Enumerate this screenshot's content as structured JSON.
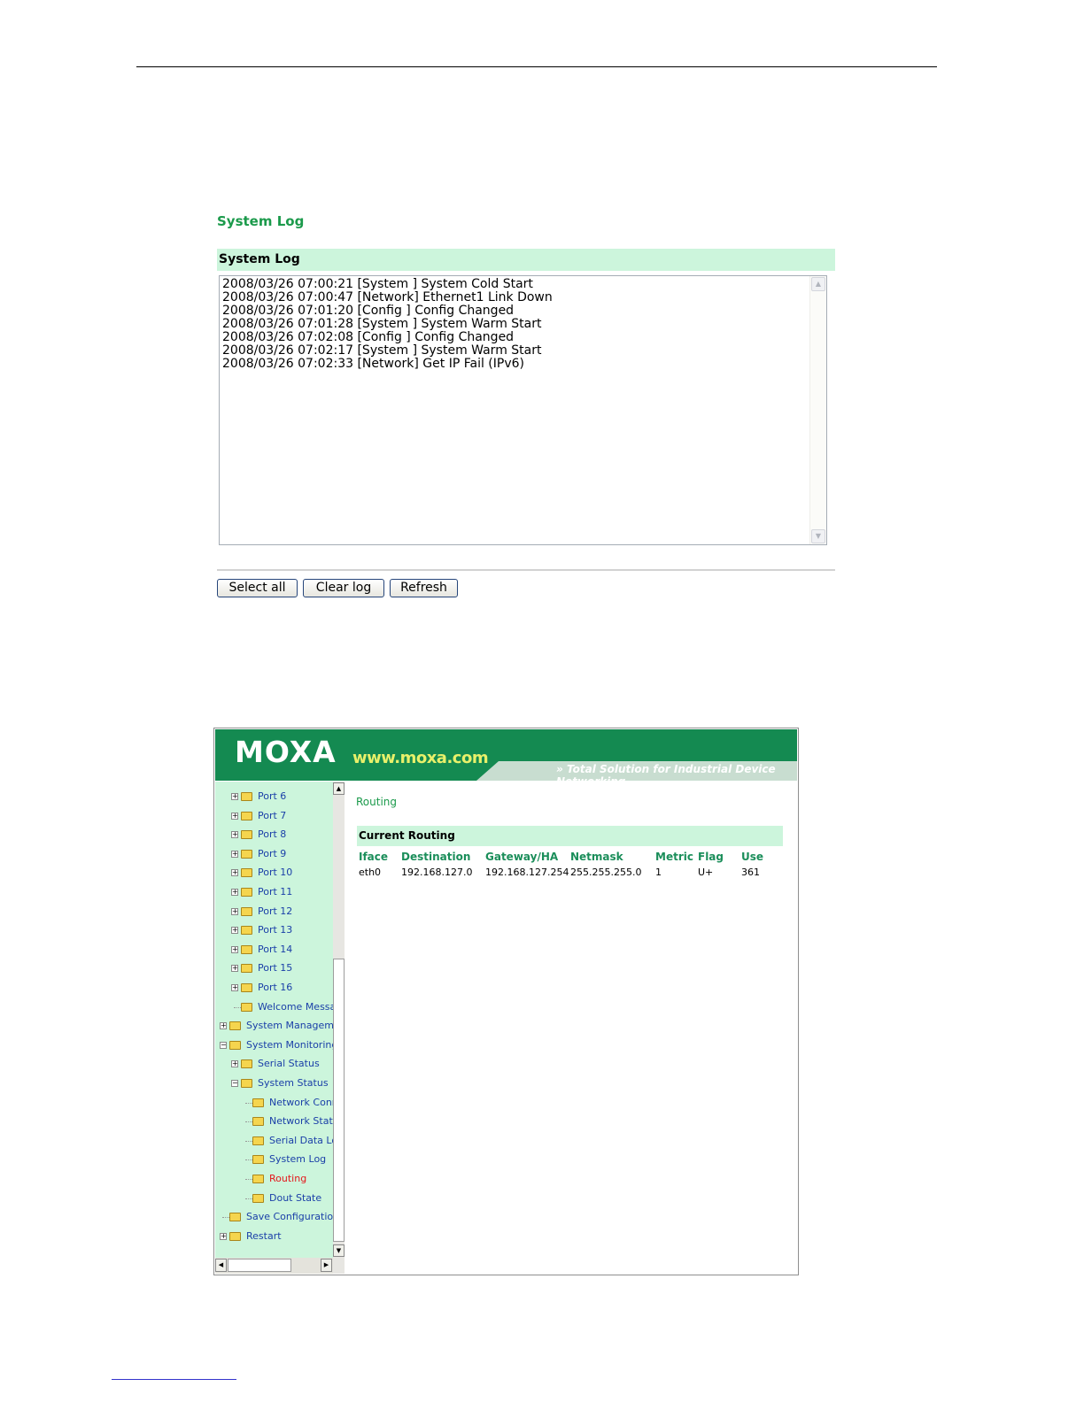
{
  "system_log": {
    "page_title": "System Log",
    "panel_header": "System Log",
    "entries": [
      "2008/03/26 07:00:21 [System ] System Cold Start",
      "2008/03/26 07:00:47 [Network] Ethernet1 Link Down",
      "2008/03/26 07:01:20 [Config ] Config Changed",
      "2008/03/26 07:01:28 [System ] System Warm Start",
      "2008/03/26 07:02:08 [Config ] Config Changed",
      "2008/03/26 07:02:17 [System ] System Warm Start",
      "2008/03/26 07:02:33 [Network] Get IP Fail (IPv6)"
    ],
    "buttons": {
      "select_all": "Select all",
      "clear_log": "Clear log",
      "refresh": "Refresh"
    }
  },
  "moxa": {
    "logo": "MOXA",
    "url": "www.moxa.com",
    "tagline": "Total Solution for Industrial Device Networking",
    "sidebar": [
      {
        "label": "Port 6",
        "level": 1,
        "expander": "+"
      },
      {
        "label": "Port 7",
        "level": 1,
        "expander": "+"
      },
      {
        "label": "Port 8",
        "level": 1,
        "expander": "+"
      },
      {
        "label": "Port 9",
        "level": 1,
        "expander": "+"
      },
      {
        "label": "Port 10",
        "level": 1,
        "expander": "+"
      },
      {
        "label": "Port 11",
        "level": 1,
        "expander": "+"
      },
      {
        "label": "Port 12",
        "level": 1,
        "expander": "+"
      },
      {
        "label": "Port 13",
        "level": 1,
        "expander": "+"
      },
      {
        "label": "Port 14",
        "level": 1,
        "expander": "+"
      },
      {
        "label": "Port 15",
        "level": 1,
        "expander": "+"
      },
      {
        "label": "Port 16",
        "level": 1,
        "expander": "+"
      },
      {
        "label": "Welcome Messag",
        "level": 1,
        "expander": ""
      },
      {
        "label": "System Managemer",
        "level": 0,
        "expander": "+"
      },
      {
        "label": "System Monitoring",
        "level": 0,
        "expander": "-"
      },
      {
        "label": "Serial Status",
        "level": 1,
        "expander": "+"
      },
      {
        "label": "System Status",
        "level": 1,
        "expander": "-"
      },
      {
        "label": "Network Conne",
        "level": 2,
        "expander": ""
      },
      {
        "label": "Network Statis",
        "level": 2,
        "expander": ""
      },
      {
        "label": "Serial Data Log",
        "level": 2,
        "expander": ""
      },
      {
        "label": "System Log",
        "level": 2,
        "expander": ""
      },
      {
        "label": "Routing",
        "level": 2,
        "expander": "",
        "active": true
      },
      {
        "label": "Dout State",
        "level": 2,
        "expander": ""
      },
      {
        "label": "Save Configuration",
        "level": 0,
        "expander": ""
      },
      {
        "label": "Restart",
        "level": 0,
        "expander": "+"
      }
    ],
    "routing": {
      "title": "Routing",
      "header": "Current Routing",
      "columns": [
        "Iface",
        "Destination",
        "Gateway/HA",
        "Netmask",
        "Metric",
        "Flag",
        "Use"
      ],
      "rows": [
        [
          "eth0",
          "192.168.127.0",
          "192.168.127.254",
          "255.255.255.0",
          "1",
          "U+",
          "361"
        ]
      ]
    }
  }
}
